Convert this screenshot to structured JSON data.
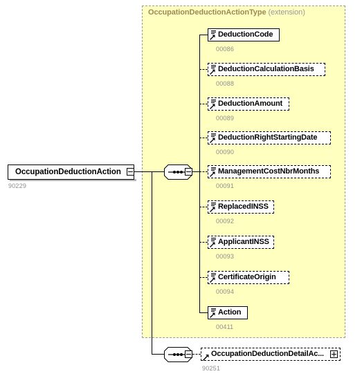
{
  "diagram": {
    "kind": "xsd-schema-diagram",
    "root": {
      "name": "OccupationDeductionAction",
      "caption": "90229",
      "toggle": "collapse-minus"
    },
    "type_panel": {
      "type_name": "OccupationDeductionActionType",
      "derivation": "(extension)"
    },
    "sequence_groups": [
      {
        "id": "sequence-main",
        "symbol": "sequence",
        "toggle": "collapse-minus"
      },
      {
        "id": "sequence-detail",
        "symbol": "sequence",
        "toggle": "collapse-minus"
      }
    ],
    "elements": [
      {
        "name": "DeductionCode",
        "caption": "00086",
        "occurrence": "required",
        "icon": "element-icon",
        "toggle": "none"
      },
      {
        "name": "DeductionCalculationBasis",
        "caption": "00088",
        "occurrence": "optional",
        "icon": "element-icon",
        "toggle": "none"
      },
      {
        "name": "DeductionAmount",
        "caption": "00089",
        "occurrence": "optional",
        "icon": "element-icon",
        "toggle": "none"
      },
      {
        "name": "DeductionRightStartingDate",
        "caption": "00090",
        "occurrence": "optional",
        "icon": "element-icon",
        "toggle": "none"
      },
      {
        "name": "ManagementCostNbrMonths",
        "caption": "00091",
        "occurrence": "optional",
        "icon": "element-icon",
        "toggle": "none"
      },
      {
        "name": "ReplacedINSS",
        "caption": "00092",
        "occurrence": "optional",
        "icon": "element-icon",
        "toggle": "none"
      },
      {
        "name": "ApplicantINSS",
        "caption": "00093",
        "occurrence": "optional",
        "icon": "element-icon",
        "toggle": "none"
      },
      {
        "name": "CertificateOrigin",
        "caption": "00094",
        "occurrence": "optional",
        "icon": "element-icon",
        "toggle": "none"
      },
      {
        "name": "Action",
        "caption": "00411",
        "occurrence": "required",
        "icon": "element-icon",
        "toggle": "none"
      }
    ],
    "detail_element": {
      "name": "OccupationDeductionDetailAc...",
      "caption": "90251",
      "occurrence": "optional",
      "icon": "reference-icon",
      "toggle": "expand-plus"
    },
    "colors": {
      "panel_fill": "#ffffc0",
      "panel_border": "#999999",
      "type_title": "#9b8b54",
      "derivation_text": "#9a9a9a",
      "caption_text": "#8d8d8d",
      "node_fill": "#ffffff",
      "node_border": "#000000",
      "shadow": "#b6b6b6"
    }
  }
}
